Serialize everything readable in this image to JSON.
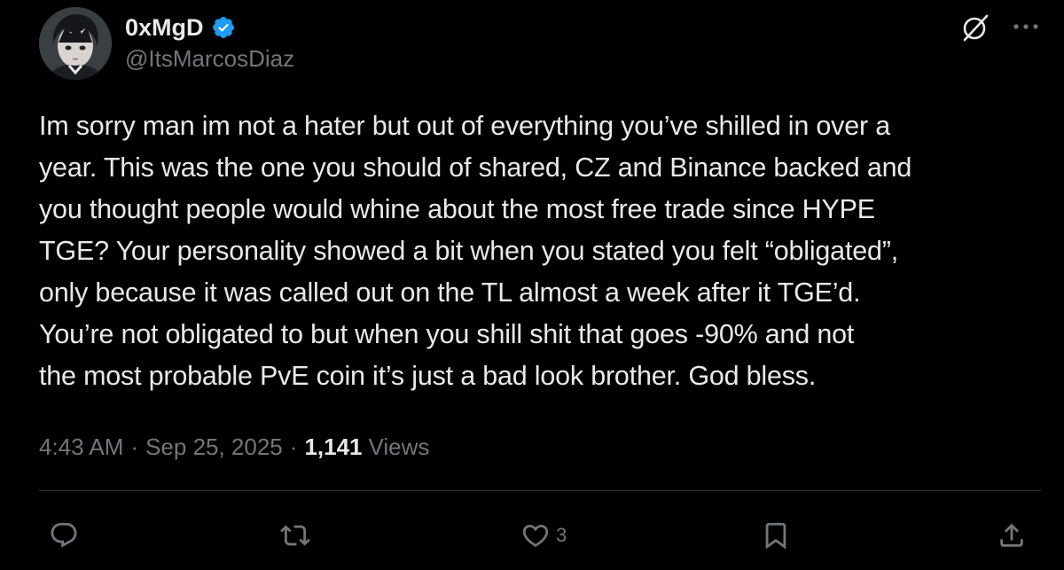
{
  "author": {
    "display_name": "0xMgD",
    "handle": "@ItsMarcosDiaz",
    "verified": true
  },
  "tweet": {
    "text_lines": [
      "Im sorry man im not a hater but out of everything you’ve shilled in over a",
      "year. This was the one you should of shared, CZ and Binance backed and",
      "you thought people would whine about the most free trade since HYPE",
      "TGE? Your personality showed a bit when you stated you felt “obligated”,",
      "only because it was called out on the TL almost a week after it TGE’d.",
      "You’re not obligated to but when you shill shit that goes -90% and not",
      "the most probable PvE coin it’s just a bad look brother. God bless."
    ]
  },
  "meta": {
    "time": "4:43 AM",
    "separator": "·",
    "date": "Sep 25, 2025",
    "views_count": "1,141",
    "views_label": "Views"
  },
  "actions": {
    "reply_icon": "reply-icon",
    "repost_icon": "repost-icon",
    "like_icon": "heart-icon",
    "like_count": "3",
    "bookmark_icon": "bookmark-icon",
    "share_icon": "share-icon"
  },
  "header_icons": {
    "grok": "grok-icon",
    "more": "more-icon"
  },
  "colors": {
    "background": "#000000",
    "text_primary": "#e7e9ea",
    "text_secondary": "#71767b",
    "verified_blue": "#1d9bf0",
    "divider": "#2f3336"
  }
}
